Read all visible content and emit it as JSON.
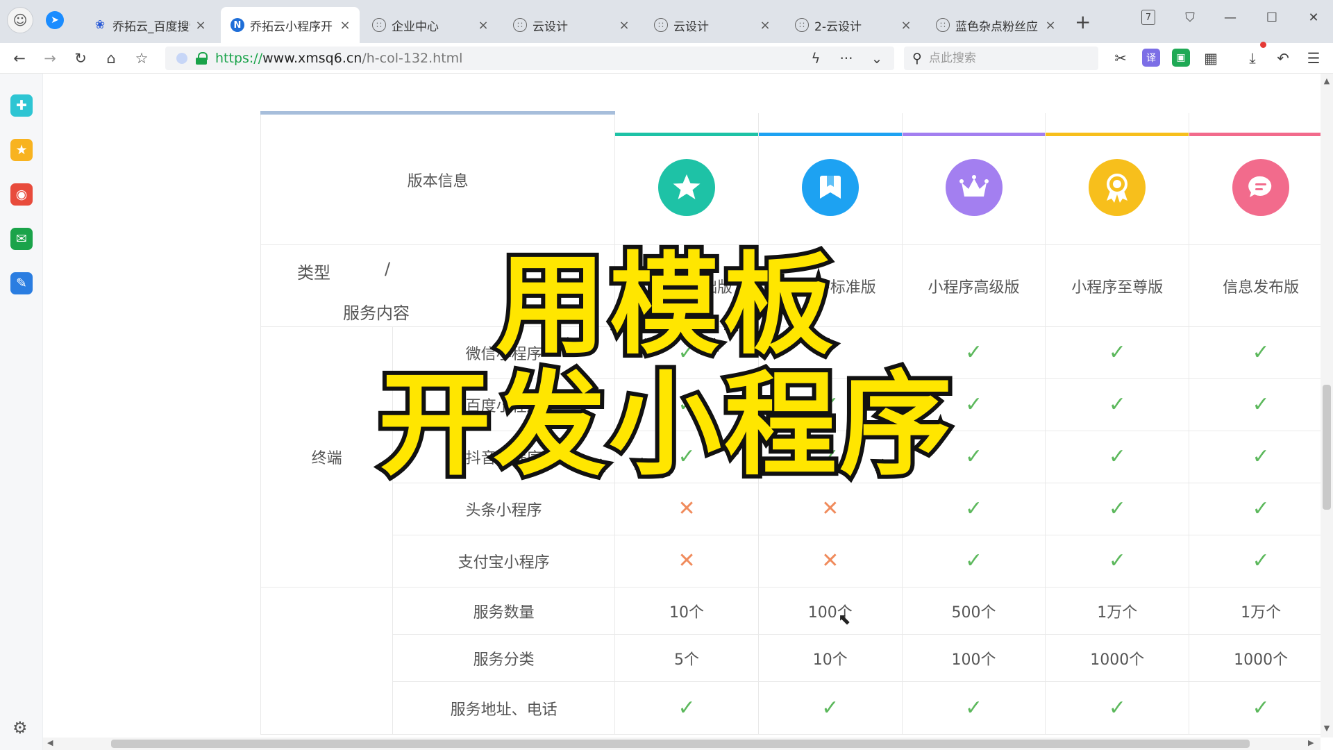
{
  "browser": {
    "tabs": [
      {
        "title": "乔拓云_百度搜索",
        "favicon": "baidu-paw",
        "active": false
      },
      {
        "title": "乔拓云小程序开",
        "favicon": "n-logo",
        "active": true
      },
      {
        "title": "企业中心",
        "favicon": "globe",
        "active": false
      },
      {
        "title": "云设计",
        "favicon": "globe",
        "active": false
      },
      {
        "title": "云设计",
        "favicon": "globe",
        "active": false
      },
      {
        "title": "2-云设计",
        "favicon": "globe",
        "active": false
      },
      {
        "title": "蓝色杂点粉丝应",
        "favicon": "globe",
        "active": false
      }
    ],
    "window_badge": "7",
    "url": {
      "scheme": "https://",
      "host": "www.xmsq6.cn",
      "path": "/h-col-132.html"
    },
    "search": {
      "placeholder": "点此搜索"
    },
    "colors": {
      "secure": "#1aa34a",
      "tab_strip": "#dfe3e9"
    }
  },
  "page": {
    "header": {
      "version_label": "版本信息",
      "type_label": "类型",
      "slash": "/",
      "service_label": "服务内容"
    },
    "plans": [
      {
        "name": "小程序基础版",
        "icon": "star-icon",
        "color": "#1ec2a6"
      },
      {
        "name": "小程序标准版",
        "icon": "bookmark-icon",
        "color": "#1da2f2"
      },
      {
        "name": "小程序高级版",
        "icon": "crown-icon",
        "color": "#a37ff0"
      },
      {
        "name": "小程序至尊版",
        "icon": "award-icon",
        "color": "#f7bf1c"
      },
      {
        "name": "信息发布版",
        "icon": "message-icon",
        "color": "#f26b8c"
      }
    ],
    "terminal_group": {
      "label": "终端",
      "rows": [
        {
          "label": "微信小程序",
          "values": [
            "check",
            "check",
            "check",
            "check",
            "check"
          ]
        },
        {
          "label": "百度小程序",
          "values": [
            "check",
            "check",
            "check",
            "check",
            "check"
          ]
        },
        {
          "label": "抖音小程序",
          "values": [
            "check",
            "check",
            "check",
            "check",
            "check"
          ]
        },
        {
          "label": "头条小程序",
          "values": [
            "cross",
            "cross",
            "check",
            "check",
            "check"
          ]
        },
        {
          "label": "支付宝小程序",
          "values": [
            "cross",
            "cross",
            "check",
            "check",
            "check"
          ]
        }
      ]
    },
    "service_group": {
      "label": "",
      "rows": [
        {
          "label": "服务数量",
          "values": [
            "10个",
            "100个",
            "500个",
            "1万个",
            "1万个"
          ]
        },
        {
          "label": "服务分类",
          "values": [
            "5个",
            "10个",
            "100个",
            "1000个",
            "1000个"
          ]
        },
        {
          "label": "服务地址、电话",
          "values": [
            "check",
            "check",
            "check",
            "check",
            "check"
          ]
        }
      ]
    },
    "colors": {
      "check": "#5cb85c",
      "cross": "#f08b5c",
      "version_bar": "#a7bedb"
    }
  },
  "overlay": {
    "line1": "用模板",
    "line2": "开发小程序",
    "fill": "#ffe600",
    "stroke": "#111111"
  },
  "sidebar": {
    "icons": [
      {
        "name": "app-plus-icon",
        "color": "#2ec5d3"
      },
      {
        "name": "favorites-star-icon",
        "color": "#f8b320"
      },
      {
        "name": "weibo-icon",
        "color": "#e84b3c"
      },
      {
        "name": "mail-icon",
        "color": "#1aa34a"
      },
      {
        "name": "notes-icon",
        "color": "#2a7de1"
      }
    ]
  }
}
